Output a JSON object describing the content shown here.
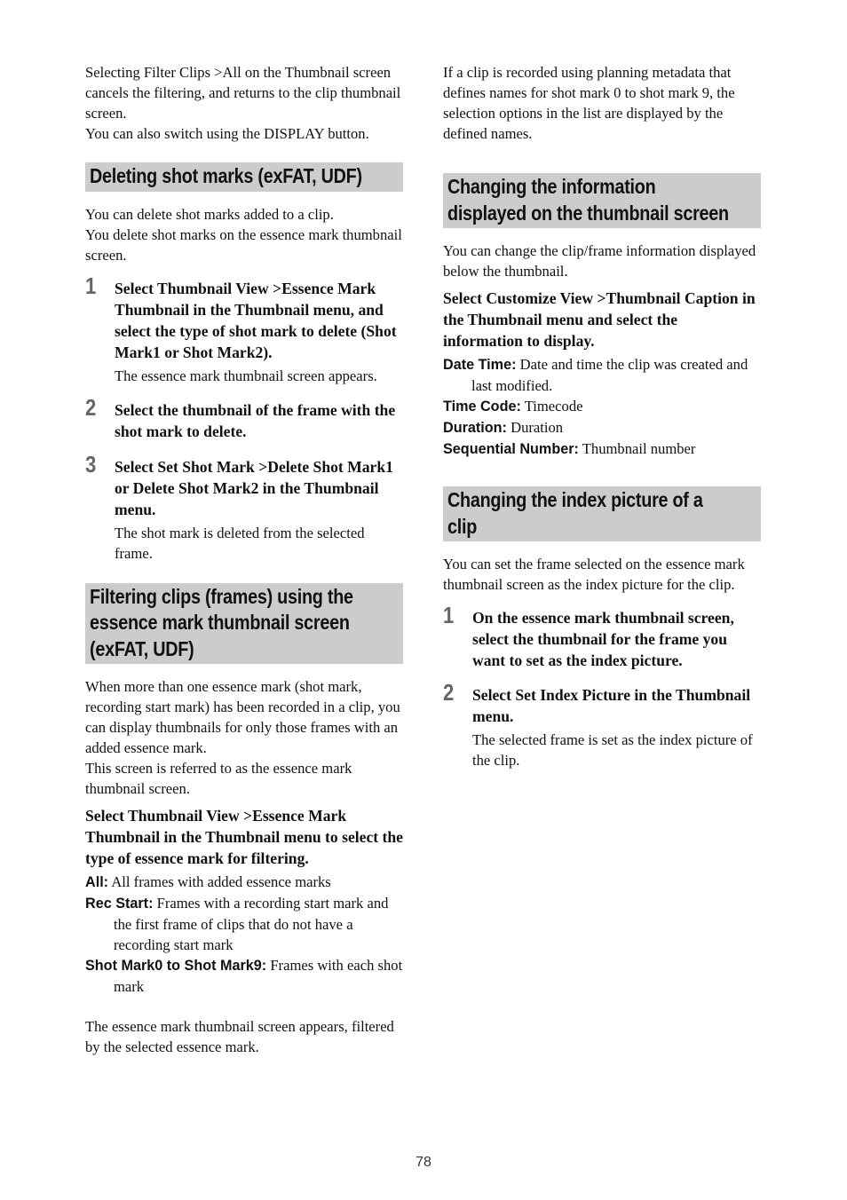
{
  "left": {
    "intro": [
      "Selecting Filter Clips >All on the Thumbnail screen cancels the filtering, and returns to the clip thumbnail screen.",
      "You can also switch using the DISPLAY button."
    ],
    "section1": {
      "heading": "Deleting shot marks (exFAT, UDF)",
      "body": [
        "You can delete shot marks added to a clip.",
        "You delete shot marks on the essence mark thumbnail screen."
      ],
      "steps": [
        {
          "num": "1",
          "text": "Select Thumbnail View >Essence Mark Thumbnail in the Thumbnail menu, and select the type of shot mark to delete (Shot Mark1 or Shot Mark2).",
          "result": "The essence mark thumbnail screen appears."
        },
        {
          "num": "2",
          "text": "Select the thumbnail of the frame with the shot mark to delete.",
          "result": ""
        },
        {
          "num": "3",
          "text": "Select Set Shot Mark >Delete Shot Mark1 or Delete Shot Mark2 in the Thumbnail menu.",
          "result": "The shot mark is deleted from the selected frame."
        }
      ]
    },
    "section2": {
      "heading_lines": [
        "Filtering clips (frames) using the",
        "essence mark thumbnail screen",
        "(exFAT, UDF)"
      ],
      "body": [
        "When more than one essence mark (shot mark, recording start mark) has been recorded in a clip, you can display thumbnails for only those frames with an added essence mark.",
        "This screen is referred to as the essence mark thumbnail screen."
      ],
      "instruction": "Select Thumbnail View >Essence Mark Thumbnail in the Thumbnail menu to select the type of essence mark for filtering.",
      "definitions": [
        {
          "term": "All:",
          "desc": "All frames with added essence marks"
        },
        {
          "term": "Rec Start:",
          "desc": "Frames with a recording start mark and the first frame of clips that do not have a recording start mark"
        },
        {
          "term": "Shot Mark0 to Shot Mark9:",
          "desc": "Frames with each shot mark"
        }
      ],
      "result": "The essence mark thumbnail screen appears, filtered by the selected essence mark."
    }
  },
  "right": {
    "intro": "If a clip is recorded using planning metadata that defines names for shot mark 0 to shot mark 9, the selection options in the list are displayed by the defined names.",
    "section3": {
      "heading_lines": [
        "Changing the information",
        "displayed on the thumbnail screen"
      ],
      "body": "You can change the clip/frame information displayed below the thumbnail.",
      "instruction": "Select Customize View >Thumbnail Caption in the Thumbnail menu and select the information to display.",
      "definitions": [
        {
          "term": "Date Time:",
          "desc": "Date and time the clip was created and last modified."
        },
        {
          "term": "Time Code:",
          "desc": "Timecode"
        },
        {
          "term": "Duration:",
          "desc": "Duration"
        },
        {
          "term": "Sequential Number:",
          "desc": "Thumbnail number"
        }
      ]
    },
    "section4": {
      "heading_lines": [
        "Changing the index picture of a",
        "clip"
      ],
      "body": "You can set the frame selected on the essence mark thumbnail screen as the index picture for the clip.",
      "steps": [
        {
          "num": "1",
          "text": "On the essence mark thumbnail screen, select the thumbnail for the frame you want to set as the index picture.",
          "result": ""
        },
        {
          "num": "2",
          "text": "Select Set Index Picture in the Thumbnail menu.",
          "result": "The selected frame is set as the index picture of the clip."
        }
      ]
    }
  },
  "footer": {
    "page_number": "78"
  }
}
